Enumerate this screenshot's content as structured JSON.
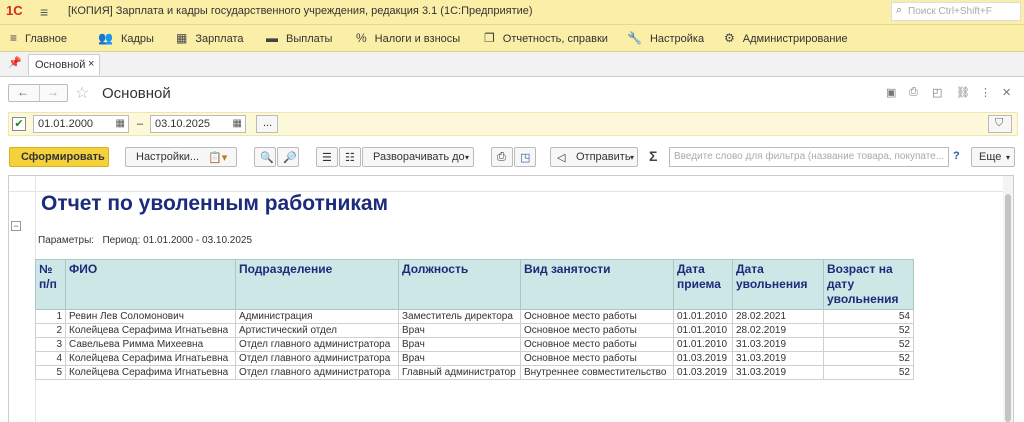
{
  "titlebar": {
    "logo": "1С",
    "title": "[КОПИЯ] Зарплата и кадры государственного учреждения, редакция 3.1  (1С:Предприятие)",
    "search_placeholder": "Поиск Ctrl+Shift+F"
  },
  "menu": [
    {
      "label": "Главное",
      "icon": "hamburger-icon"
    },
    {
      "label": "Кадры",
      "icon": "people-icon"
    },
    {
      "label": "Зарплата",
      "icon": "calculator-icon"
    },
    {
      "label": "Выплаты",
      "icon": "wallet-icon"
    },
    {
      "label": "Налоги и взносы",
      "icon": "percent-icon"
    },
    {
      "label": "Отчетность, справки",
      "icon": "document-icon"
    },
    {
      "label": "Настройка",
      "icon": "wrench-icon"
    },
    {
      "label": "Администрирование",
      "icon": "gear-icon"
    }
  ],
  "tabs": [
    {
      "label": "Основной"
    }
  ],
  "form": {
    "title": "Основной"
  },
  "period": {
    "from": "01.01.2000",
    "dash": "–",
    "to": "03.10.2025",
    "more": "..."
  },
  "toolbar": {
    "generate": "Сформировать",
    "settings": "Настройки...",
    "expand": "Разворачивать до",
    "send": "Отправить",
    "sigma": "Σ",
    "filter_placeholder": "Введите слово для фильтра (название товара, покупате...",
    "help": "?",
    "more": "Еще"
  },
  "report": {
    "title": "Отчет по уволенным работникам",
    "params_label": "Параметры:",
    "params_value": "Период: 01.01.2000 - 03.10.2025",
    "columns": [
      "№ п/п",
      "ФИО",
      "Подразделение",
      "Должность",
      "Вид занятости",
      "Дата приема",
      "Дата увольнения",
      "Возраст на дату увольнения"
    ],
    "rows": [
      [
        "1",
        "Ревин Лев Соломонович",
        "Администрация",
        "Заместитель директора",
        "Основное место работы",
        "01.01.2010",
        "28.02.2021",
        "54"
      ],
      [
        "2",
        "Колейцева Серафима Игнатьевна",
        "Артистический отдел",
        "Врач",
        "Основное место работы",
        "01.01.2010",
        "28.02.2019",
        "52"
      ],
      [
        "3",
        "Савельева Римма Михеевна",
        "Отдел главного администратора",
        "Врач",
        "Основное место работы",
        "01.01.2010",
        "31.03.2019",
        "52"
      ],
      [
        "4",
        "Колейцева Серафима Игнатьевна",
        "Отдел главного администратора",
        "Врач",
        "Основное место работы",
        "01.03.2019",
        "31.03.2019",
        "52"
      ],
      [
        "5",
        "Колейцева Серафима Игнатьевна",
        "Отдел главного администратора",
        "Главный администратор",
        "Внутреннее совместительство",
        "01.03.2019",
        "31.03.2019",
        "52"
      ]
    ]
  }
}
